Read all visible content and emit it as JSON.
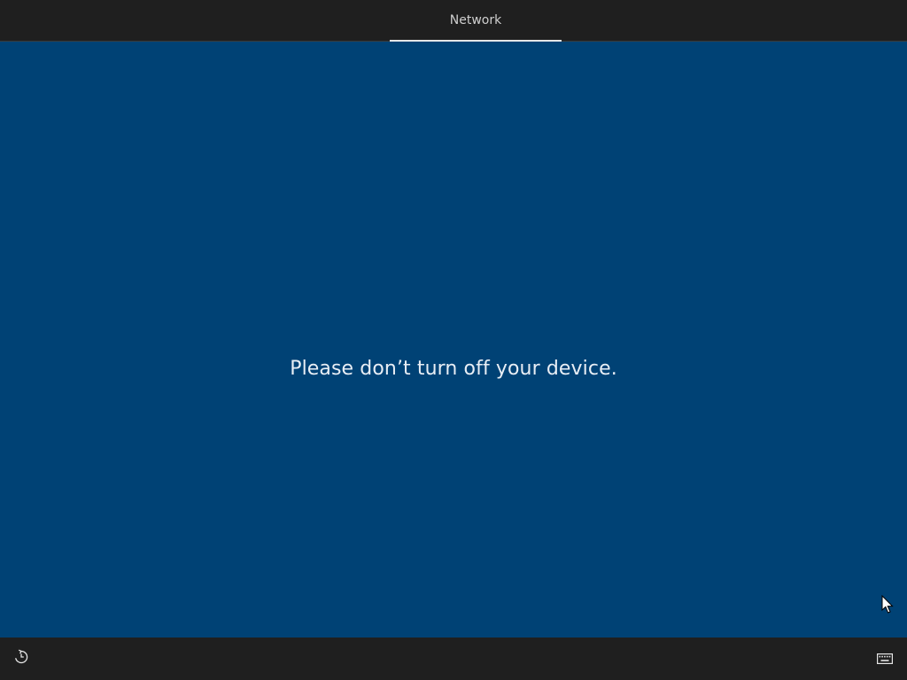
{
  "header": {
    "step_label": "Network"
  },
  "main": {
    "message": "Please don’t turn off your device."
  },
  "footer": {
    "left_icon": "ease-of-access-icon",
    "right_icon": "keyboard-icon"
  },
  "colors": {
    "background": "#004275",
    "bars": "#1f1f1f",
    "text": "#e8eef5"
  }
}
